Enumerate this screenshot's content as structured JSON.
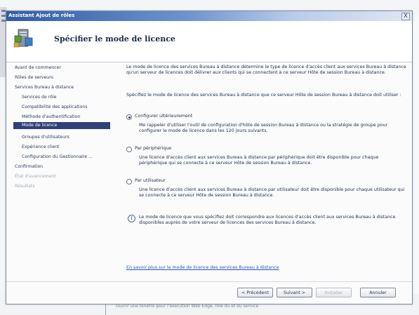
{
  "dialog": {
    "title": "Assistant Ajout de rôles",
    "close_label": "X",
    "header_title": "Spécifier le mode de licence"
  },
  "nav": {
    "items": [
      {
        "label": "Avant de commencer",
        "state": "normal"
      },
      {
        "label": "Rôles de serveurs",
        "state": "normal"
      },
      {
        "label": "Services Bureau à distance",
        "state": "normal"
      },
      {
        "label": "Services de rôle",
        "state": "normal"
      },
      {
        "label": "Compatibilité des applications",
        "state": "normal"
      },
      {
        "label": "Méthode d'authentification",
        "state": "normal"
      },
      {
        "label": "Mode de licence",
        "state": "active"
      },
      {
        "label": "Groupes d'utilisateurs",
        "state": "normal"
      },
      {
        "label": "Expérience client",
        "state": "normal"
      },
      {
        "label": "Configuration du Gestionnaire ...",
        "state": "normal"
      },
      {
        "label": "Confirmation",
        "state": "normal"
      },
      {
        "label": "État d'avancement",
        "state": "disabled"
      },
      {
        "label": "Résultats",
        "state": "disabled"
      }
    ]
  },
  "main": {
    "intro": "Le mode de licence des services Bureau à distance détermine le type de licence d'accès client aux services Bureau à distance qu'un serveur de licences doit délivrer aux clients qui se connectent à ce serveur Hôte de session Bureau à distance.",
    "instruction": "Spécifiez le mode de licence des services Bureau à distance que ce serveur Hôte de session Bureau à distance doit utiliser :",
    "options": [
      {
        "label": "Configurer ultérieurement",
        "selected": true,
        "desc": "Me rappeler d'utiliser l'outil de configuration d'hôte de session Bureau à distance ou la stratégie de groupe pour configurer le mode de licence dans les 120 jours suivants."
      },
      {
        "label": "Par périphérique",
        "selected": false,
        "desc": "Une licence d'accès client aux services Bureau à distance par périphérique doit être disponible pour chaque périphérique qui se connecte à ce serveur Hôte de session Bureau à distance."
      },
      {
        "label": "Par utilisateur",
        "selected": false,
        "desc": "Une licence d'accès client aux services Bureau à distance par utilisateur doit être disponible pour chaque utilisateur qui se connecte à ce serveur Hôte de session Bureau à distance."
      }
    ],
    "info_text": "Le mode de licence que vous spécifiez doit correspondre aux licences d'accès client aux services Bureau à distance disponibles auprès de votre serveur de licences des services Bureau à distance.",
    "link": "En savoir plus sur le mode de licence des services Bureau à distance"
  },
  "buttons": {
    "previous": "< Précédent",
    "next": "Suivant >",
    "install": "Installer",
    "cancel": "Annuler"
  },
  "background": {
    "status_text": "Ouvrir une fenêtre pour l'exécution Web Edge, rôle du et du service"
  }
}
